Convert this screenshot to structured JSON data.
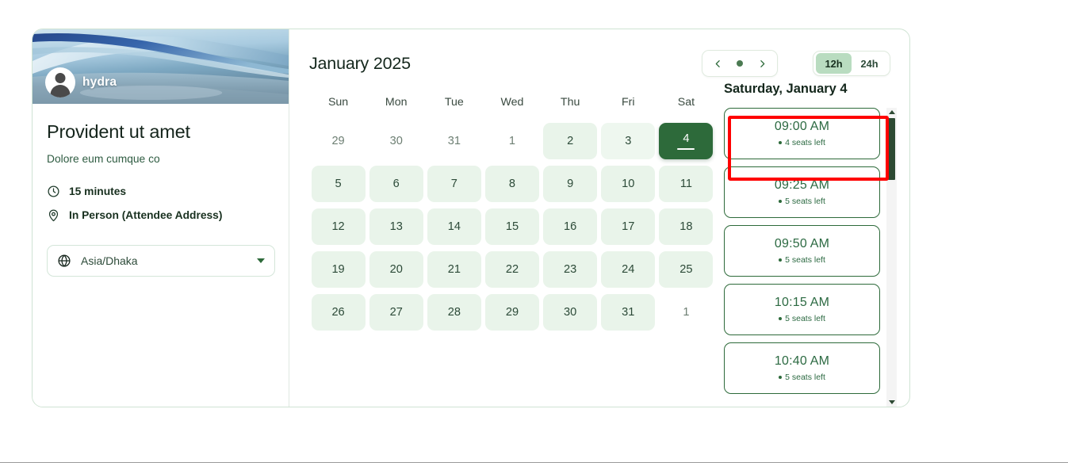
{
  "profile": {
    "username": "hydra",
    "avatar_icon": "user-avatar-icon",
    "banner_icon": "abstract-wave-banner"
  },
  "event": {
    "title": "Provident ut amet",
    "subtitle": "Dolore eum cumque co",
    "duration": "15 minutes",
    "duration_icon": "clock-icon",
    "location": "In Person (Attendee Address)",
    "location_icon": "map-pin-icon"
  },
  "timezone": {
    "icon": "globe-icon",
    "value": "Asia/Dhaka",
    "caret_icon": "chevron-down-icon"
  },
  "calendar": {
    "month_title": "January 2025",
    "nav": {
      "prev_icon": "chevron-left-icon",
      "prev_label": "<",
      "today_dot_icon": "dot-icon",
      "next_icon": "chevron-right-icon",
      "next_label": ">"
    },
    "hour_format": {
      "options": [
        "12h",
        "24h"
      ],
      "selected": "12h"
    },
    "weekdays": [
      "Sun",
      "Mon",
      "Tue",
      "Wed",
      "Thu",
      "Fri",
      "Sat"
    ],
    "weeks": [
      [
        {
          "day": "29",
          "state": "muted"
        },
        {
          "day": "30",
          "state": "muted"
        },
        {
          "day": "31",
          "state": "muted"
        },
        {
          "day": "1",
          "state": "muted"
        },
        {
          "day": "2",
          "state": "available"
        },
        {
          "day": "3",
          "state": "hovered"
        },
        {
          "day": "4",
          "state": "selected"
        }
      ],
      [
        {
          "day": "5",
          "state": "available"
        },
        {
          "day": "6",
          "state": "available"
        },
        {
          "day": "7",
          "state": "available"
        },
        {
          "day": "8",
          "state": "available"
        },
        {
          "day": "9",
          "state": "available"
        },
        {
          "day": "10",
          "state": "available"
        },
        {
          "day": "11",
          "state": "available"
        }
      ],
      [
        {
          "day": "12",
          "state": "available"
        },
        {
          "day": "13",
          "state": "available"
        },
        {
          "day": "14",
          "state": "available"
        },
        {
          "day": "15",
          "state": "available"
        },
        {
          "day": "16",
          "state": "available"
        },
        {
          "day": "17",
          "state": "available"
        },
        {
          "day": "18",
          "state": "available"
        }
      ],
      [
        {
          "day": "19",
          "state": "available"
        },
        {
          "day": "20",
          "state": "available"
        },
        {
          "day": "21",
          "state": "available"
        },
        {
          "day": "22",
          "state": "available"
        },
        {
          "day": "23",
          "state": "available"
        },
        {
          "day": "24",
          "state": "available"
        },
        {
          "day": "25",
          "state": "available"
        }
      ],
      [
        {
          "day": "26",
          "state": "available"
        },
        {
          "day": "27",
          "state": "available"
        },
        {
          "day": "28",
          "state": "available"
        },
        {
          "day": "29",
          "state": "available"
        },
        {
          "day": "30",
          "state": "available"
        },
        {
          "day": "31",
          "state": "available"
        },
        {
          "day": "1",
          "state": "muted"
        }
      ]
    ]
  },
  "slots": {
    "selected_date_label": "Saturday, January 4",
    "items": [
      {
        "time": "09:00 AM",
        "seats": "4 seats left",
        "highlighted": true
      },
      {
        "time": "09:25 AM",
        "seats": "5 seats left",
        "highlighted": false
      },
      {
        "time": "09:50 AM",
        "seats": "5 seats left",
        "highlighted": false
      },
      {
        "time": "10:15 AM",
        "seats": "5 seats left",
        "highlighted": false
      },
      {
        "time": "10:40 AM",
        "seats": "5 seats left",
        "highlighted": false
      }
    ],
    "scrollbar": {
      "up_arrow_icon": "triangle-up-icon",
      "down_arrow_icon": "triangle-down-icon"
    }
  },
  "colors": {
    "brand_green": "#2d6a3a",
    "cell_green": "#e9f4ea",
    "toggle_active": "#b9dcc0",
    "annotation_red": "#ff0000",
    "card_border": "#cfe3d3"
  }
}
